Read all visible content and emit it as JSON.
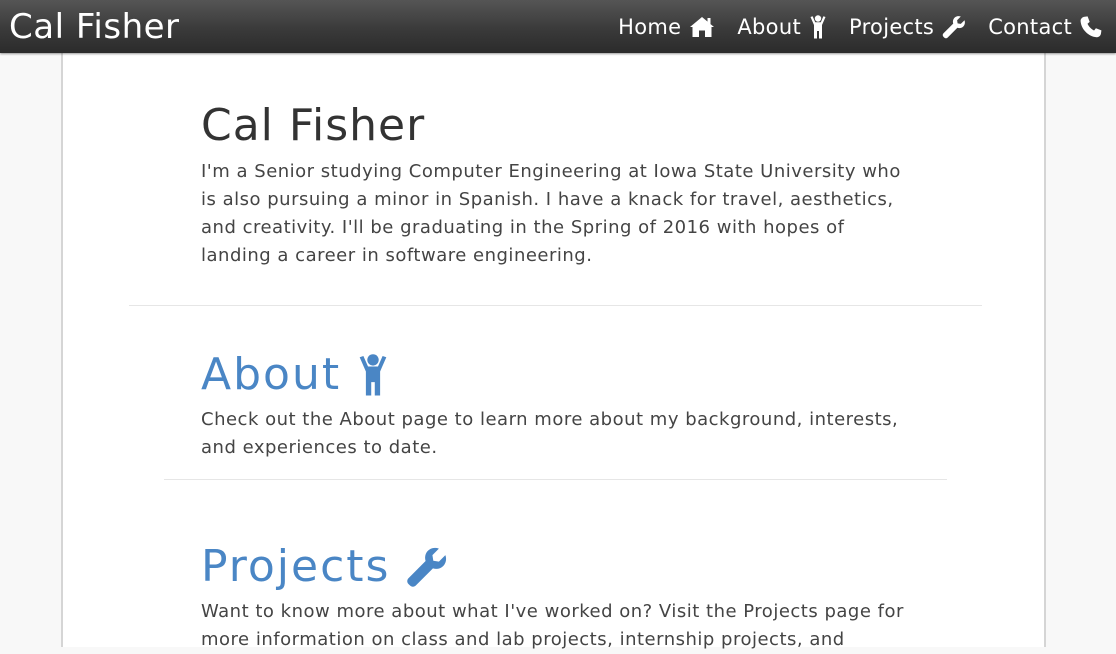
{
  "brand": "Cal Fisher",
  "nav": {
    "home": "Home",
    "about": "About",
    "projects": "Projects",
    "contact": "Contact"
  },
  "icons": {
    "home": "home-icon",
    "about": "person-icon",
    "projects": "wrench-icon",
    "contact": "phone-icon"
  },
  "colors": {
    "navbar": "#3a3a3a",
    "accent": "#4a86c5",
    "text": "#444444"
  },
  "hero": {
    "title": "Cal Fisher",
    "text": "I'm a Senior studying Computer Engineering at Iowa State University who is also pursuing a minor in Spanish. I have a knack for travel, aesthetics, and creativity. I'll be graduating in the Spring of 2016 with hopes of landing a career in software engineering."
  },
  "about": {
    "heading": "About",
    "text": "Check out the About page to learn more about my background, interests, and experiences to date."
  },
  "projects": {
    "heading": "Projects",
    "text": "Want to know more about what I've worked on? Visit the Projects page for more information on class and lab projects, internship projects, and"
  }
}
